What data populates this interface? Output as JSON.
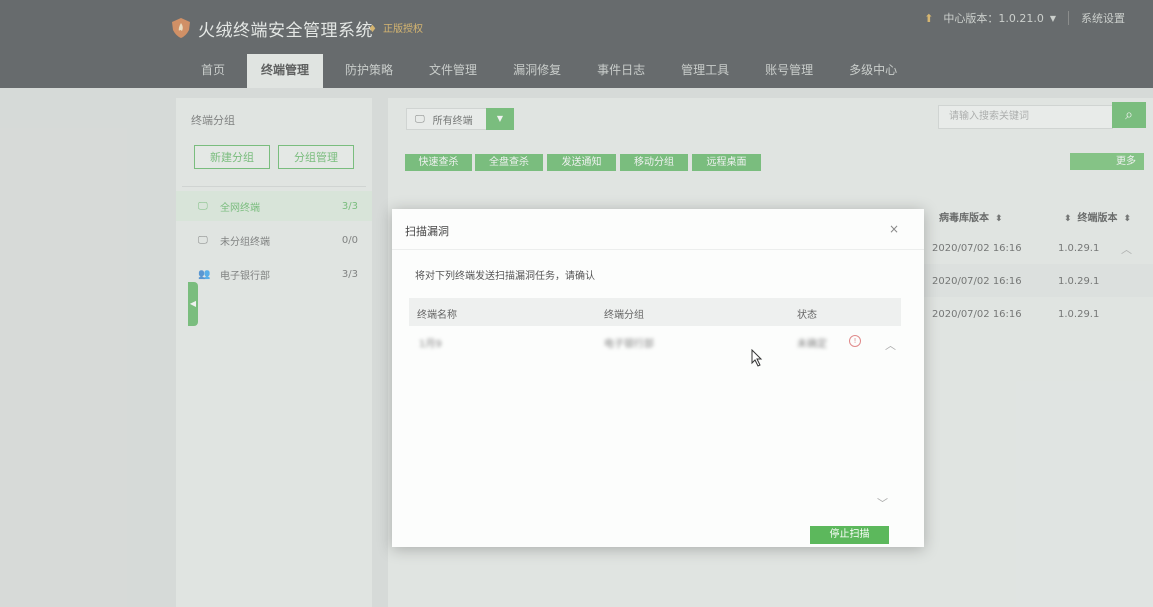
{
  "header": {
    "app_title": "火绒终端安全管理系统",
    "license_text": "正版授权",
    "version_label": "中心版本：1.0.21.0",
    "settings_label": "系统设置"
  },
  "nav": [
    {
      "label": "首页"
    },
    {
      "label": "终端管理"
    },
    {
      "label": "防护策略"
    },
    {
      "label": "文件管理"
    },
    {
      "label": "漏洞修复"
    },
    {
      "label": "事件日志"
    },
    {
      "label": "管理工具"
    },
    {
      "label": "账号管理"
    },
    {
      "label": "多级中心"
    }
  ],
  "sidebar": {
    "title": "终端分组",
    "new_group_label": "新建分组",
    "manage_group_label": "分组管理",
    "groups": [
      {
        "label": "全网终端",
        "count": "3/3"
      },
      {
        "label": "未分组终端",
        "count": "0/0"
      },
      {
        "label": "电子银行部",
        "count": "3/3"
      }
    ]
  },
  "main": {
    "terminal_select": "所有终端",
    "search_placeholder": "请输入搜索关键词",
    "actions": [
      "快速查杀",
      "全盘查杀",
      "发送通知",
      "移动分组",
      "远程桌面"
    ],
    "more_label": "更多",
    "columns": [
      "病毒库版本",
      "终端版本"
    ],
    "rows": [
      {
        "virus_db": "2020/07/02 16:16",
        "client_version": "1.0.29.1"
      },
      {
        "virus_db": "2020/07/02 16:16",
        "client_version": "1.0.29.1"
      },
      {
        "virus_db": "2020/07/02 16:16",
        "client_version": "1.0.29.1"
      }
    ]
  },
  "modal": {
    "title": "扫描漏洞",
    "close": "×",
    "message": "将对下列终端发送扫描漏洞任务，请确认",
    "columns": [
      "终端名称",
      "终端分组",
      "状态"
    ],
    "rows": [
      {
        "name": "1月9",
        "group": "电子银行部",
        "status": "未确定"
      }
    ],
    "stop_label": "停止扫描"
  },
  "colors": {
    "accent": "#4caf50",
    "header_bg": "#2f3236"
  }
}
